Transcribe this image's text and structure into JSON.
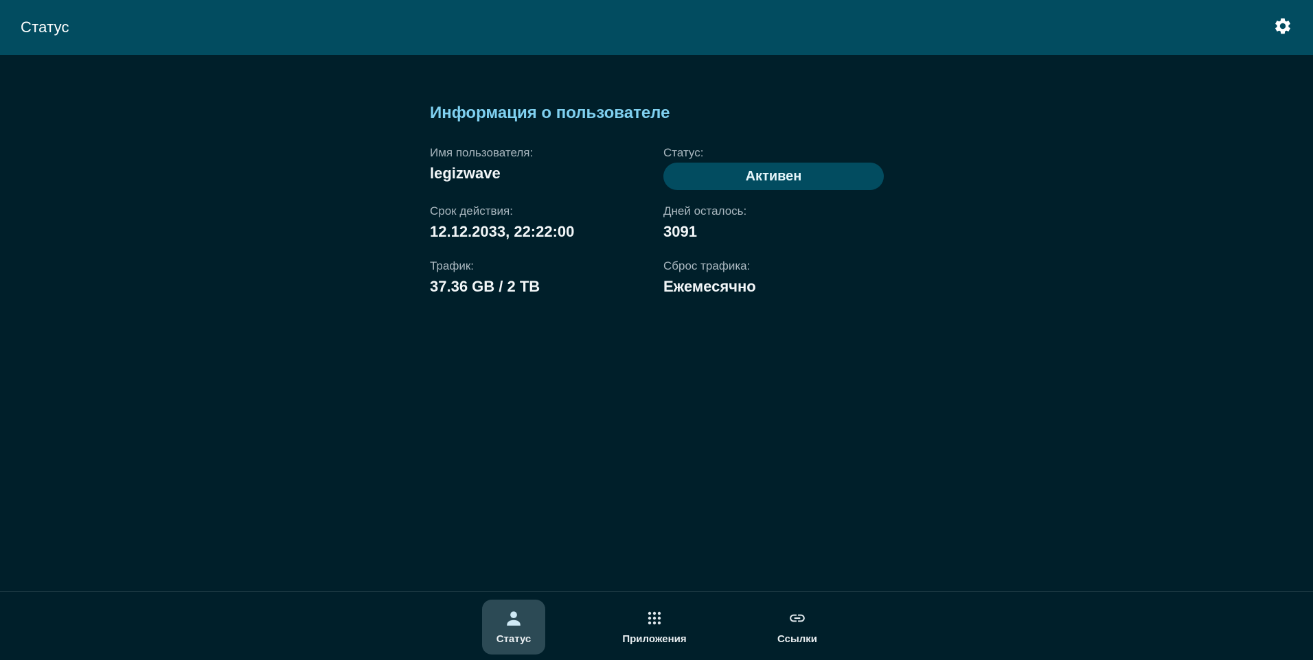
{
  "header": {
    "title": "Статус"
  },
  "user_info": {
    "title": "Информация о пользователе",
    "fields": {
      "username": {
        "label": "Имя пользователя:",
        "value": "legizwave"
      },
      "status": {
        "label": "Статус:",
        "value": "Активен"
      },
      "expiry": {
        "label": "Срок действия:",
        "value": "12.12.2033, 22:22:00"
      },
      "days_left": {
        "label": "Дней осталось:",
        "value": "3091"
      },
      "traffic": {
        "label": "Трафик:",
        "value": "37.36 GB / 2 TB"
      },
      "traffic_reset": {
        "label": "Сброс трафика:",
        "value": "Ежемесячно"
      }
    }
  },
  "bottom_nav": {
    "items": [
      {
        "label": "Статус",
        "icon": "person-icon",
        "active": true
      },
      {
        "label": "Приложения",
        "icon": "apps-grid-icon",
        "active": false
      },
      {
        "label": "Ссылки",
        "icon": "link-icon",
        "active": false
      }
    ]
  },
  "colors": {
    "header_bg": "#024c60",
    "page_bg": "#001f2a",
    "accent_title": "#7fd0f0",
    "status_badge_bg": "#024c60",
    "nav_active_bg": "#2c4a55"
  }
}
